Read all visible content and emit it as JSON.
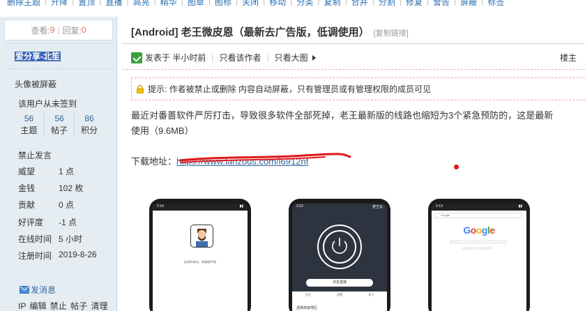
{
  "topbar": {
    "items": [
      "删除主题",
      "升降",
      "置顶",
      "直播",
      "高亮",
      "精华",
      "图章",
      "图标",
      "关闭",
      "移动",
      "分类",
      "复制",
      "合并",
      "分割",
      "修复",
      "警告",
      "屏蔽",
      "标签"
    ]
  },
  "sidebar": {
    "views_label": "查看:",
    "views": "9",
    "replies_label": "回复:",
    "replies": "0",
    "username": "爱分享-北笙",
    "avatar_blocked": "头像被屏蔽",
    "not_signed": "该用户从未签到",
    "credits": [
      {
        "num": "56",
        "label": "主题"
      },
      {
        "num": "56",
        "label": "帖子"
      },
      {
        "num": "86",
        "label": "积分"
      }
    ],
    "banned": "禁止发言",
    "props": [
      {
        "label": "威望",
        "value": "1 点"
      },
      {
        "label": "金钱",
        "value": "102 枚"
      },
      {
        "label": "贡献",
        "value": "0 点"
      },
      {
        "label": "好评度",
        "value": "-1 点"
      },
      {
        "label": "在线时间",
        "value": "5 小时"
      },
      {
        "label": "注册时间",
        "value": "2019-8-26"
      }
    ],
    "message": "发消息",
    "admin_links": "IP 编辑 禁止 帖子 清理"
  },
  "post": {
    "title": "[Android] 老王微皮恩（最新去广告版，低调使用）",
    "copy_link": "[复制链接]",
    "posted": "发表于 半小时前",
    "author_only": "只看该作者",
    "big_image": "只看大图",
    "floor": "楼主",
    "notice": "提示: 作者被禁止或删除 内容自动屏蔽，只有管理员或有管理权限的成员可见",
    "body_line1": "最近对番蔷软件严厉打击，导致很多软件全部死掉，老王最新版的线路也缩短为3个紧急预防的，这是最新",
    "body_line2": "使用（9.6MB）",
    "download_label": "下载地址：",
    "download_link": "https://www.lanzous.com/i6912nf"
  },
  "screens": {
    "phone1_status": "2:14",
    "phone1_text": "[仅限本地化，请谨慎声明]",
    "phone2_status": "2:12",
    "phone2_app": "老王云",
    "phone2_button": "点击连接",
    "phone2_tabs": [
      "主页",
      "设置",
      "关于"
    ],
    "phone2_line": "选择高级地区",
    "phone3_status": "2:13",
    "phone3_url": "Google",
    "phone3_logo": "Google"
  },
  "colors": {
    "link": "#336699",
    "sidebar_bg": "#e5edf2",
    "stat_num": "#f26c4f",
    "scribble": "#e01818"
  }
}
